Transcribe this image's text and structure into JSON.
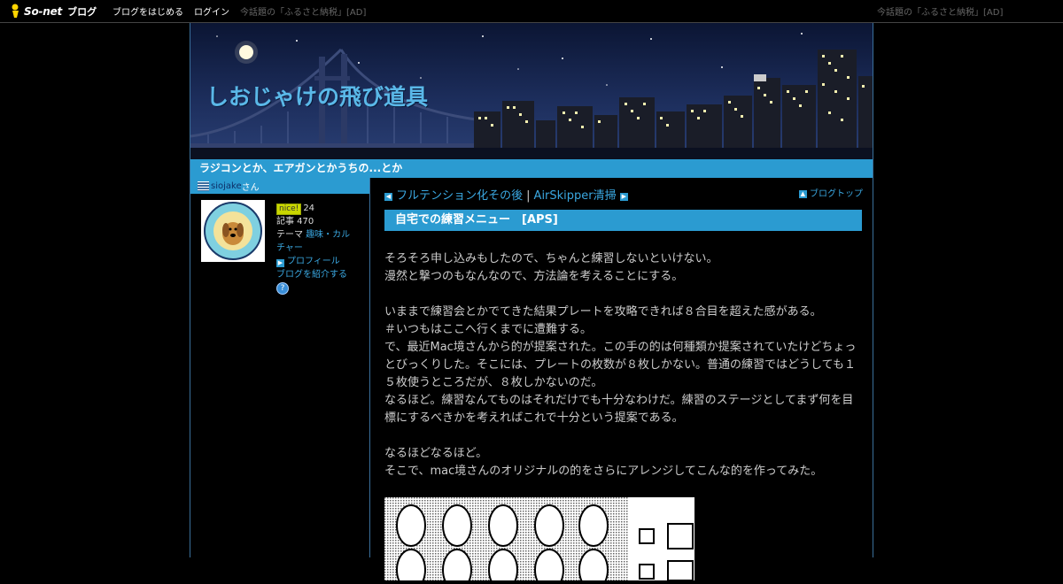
{
  "topbar": {
    "logo_text": "So-net",
    "logo_sub": "ブログ",
    "nav": [
      "ブログをはじめる",
      "ログイン"
    ],
    "ad_left": "今話題の「ふるさと納税」[AD]",
    "ad_right": "今話題の「ふるさと納税」[AD]"
  },
  "blog": {
    "title": "しおじゃけの飛び道具",
    "tagline": "ラジコンとか、エアガンとかうちの...とか"
  },
  "sidebar": {
    "user": "siojake",
    "user_suffix": " さん",
    "nice_label": "nice!",
    "nice_count": "24",
    "articles": "記事 470",
    "theme_label": "テーマ ",
    "theme_link": "趣味・カルチャー",
    "profile_link": "プロフィール",
    "introduce_link": "ブログを紹介する",
    "help": "?"
  },
  "postnav": {
    "prev": "フルテンション化その後",
    "next": "AirSkipper清掃",
    "blogtop": "ブログトップ"
  },
  "entry": {
    "title": "自宅での練習メニュー　[APS]",
    "paragraphs": [
      "そろそろ申し込みもしたので、ちゃんと練習しないといけない。",
      "漫然と撃つのもなんなので、方法論を考えることにする。",
      "",
      "いままで練習会とかでてきた結果プレートを攻略できれば８合目を超えた感がある。",
      "＃いつもはここへ行くまでに遭難する。",
      "で、最近Mac境さんから的が提案された。この手の的は何種類か提案されていたけどちょっとびっくりした。そこには、プレートの枚数が８枚しかない。普通の練習ではどうしても１５枚使うところだが、８枚しかないのだ。",
      "なるほど。練習なんてものはそれだけでも十分なわけだ。練習のステージとしてまず何を目標にするべきかを考えればこれで十分という提案である。",
      "",
      "なるほどなるほど。",
      "そこで、mac境さんのオリジナルの的をさらにアレンジしてこんな的を作ってみた。"
    ]
  }
}
